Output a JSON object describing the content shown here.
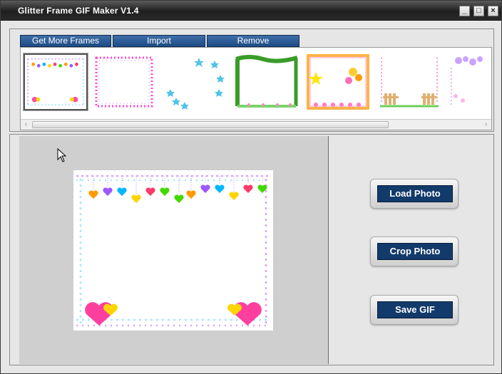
{
  "window": {
    "title": "Glitter Frame GIF Maker V1.4",
    "controls": {
      "minimize": "_",
      "maximize": "□",
      "close": "×"
    }
  },
  "tabs": [
    {
      "label": "Get More Frames"
    },
    {
      "label": "Import"
    },
    {
      "label": "Remove"
    }
  ],
  "gallery": {
    "frames": [
      {
        "name": "hanging-hearts-frame",
        "selected": true
      },
      {
        "name": "pink-dotted-frame",
        "selected": false
      },
      {
        "name": "blue-stars-frame",
        "selected": false
      },
      {
        "name": "green-vine-frame",
        "selected": false
      },
      {
        "name": "colorful-balloons-frame",
        "selected": false
      },
      {
        "name": "pink-fence-frame",
        "selected": false
      },
      {
        "name": "purple-hearts-frame",
        "selected": false
      }
    ],
    "scrollbar": {
      "left_arrow": "‹",
      "right_arrow": "›"
    }
  },
  "preview": {
    "frame": "hanging-hearts-frame"
  },
  "actions": {
    "load_label": "Load Photo",
    "crop_label": "Crop Photo",
    "save_label": "Save GIF"
  }
}
